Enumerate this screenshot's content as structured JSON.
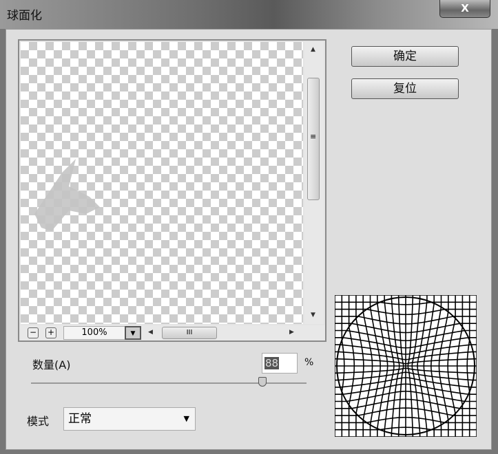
{
  "window": {
    "title": "球面化",
    "close_label": "X"
  },
  "preview": {
    "zoom_value": "100%",
    "zoom_out": "−",
    "zoom_in": "+",
    "hthumb_grip": "III",
    "vthumb_grip": "≡"
  },
  "buttons": {
    "ok": "确定",
    "reset": "复位"
  },
  "amount": {
    "label": "数量(A)",
    "value": "88",
    "unit": "%",
    "slider_fraction": 0.84
  },
  "mode": {
    "label": "模式",
    "value": "正常"
  }
}
